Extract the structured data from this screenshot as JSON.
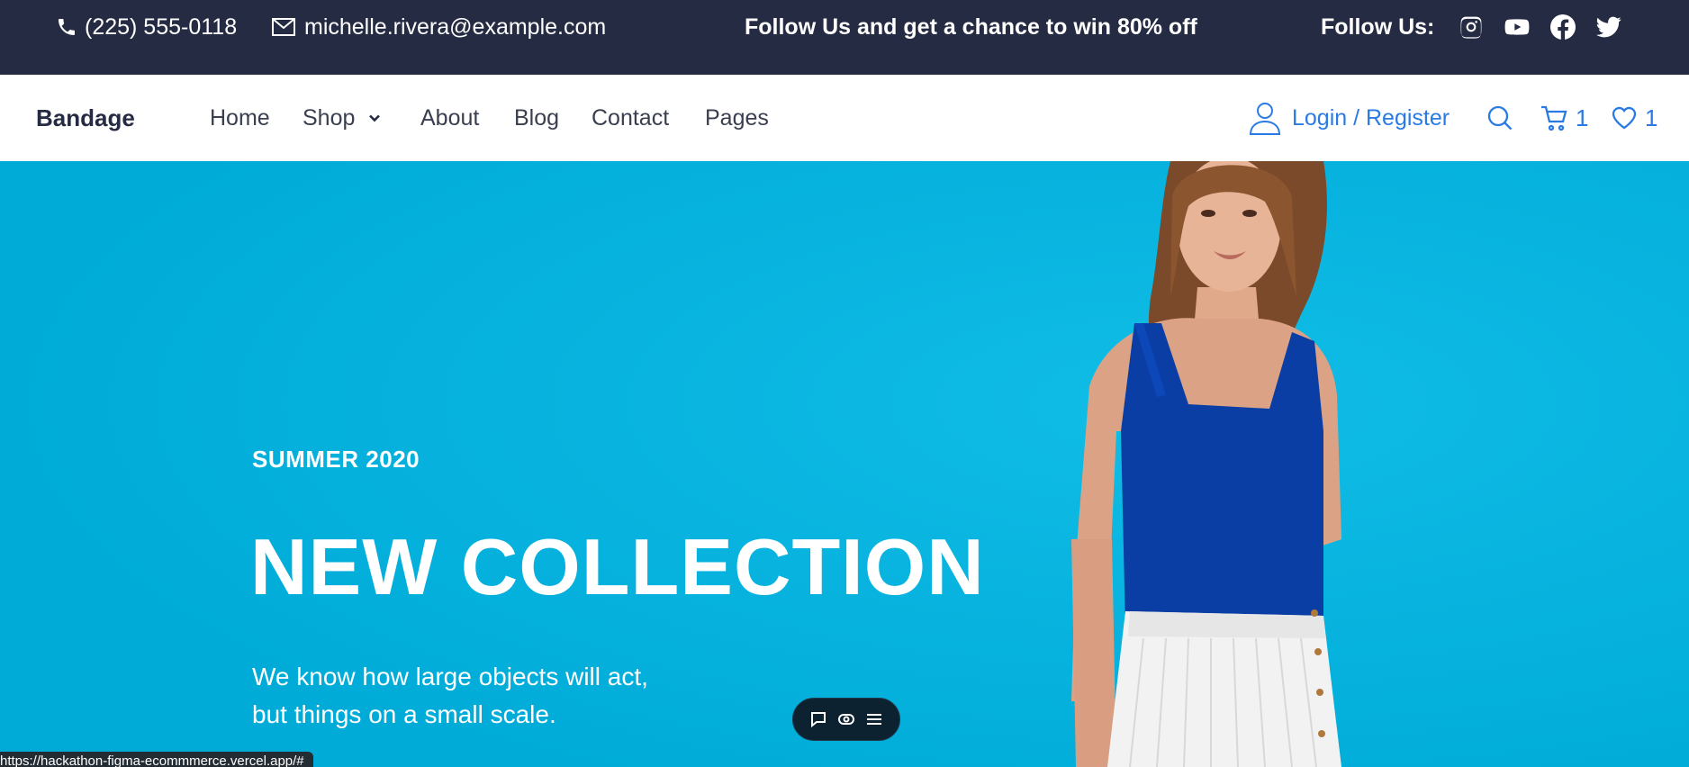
{
  "topbar": {
    "phone": "(225) 555-0118",
    "email": "michelle.rivera@example.com",
    "promo": "Follow Us and get a chance to win 80% off",
    "follow_label": "Follow Us:",
    "social_icons": [
      "instagram-icon",
      "youtube-icon",
      "facebook-icon",
      "twitter-icon"
    ]
  },
  "nav": {
    "brand": "Bandage",
    "links": [
      "Home",
      "Shop",
      "About",
      "Blog",
      "Contact",
      "Pages"
    ],
    "login": "Login / Register",
    "cart_count": "1",
    "wishlist_count": "1"
  },
  "hero": {
    "season": "SUMMER 2020",
    "headline": "NEW COLLECTION",
    "subtext_line1": "We know how large objects will act,",
    "subtext_line2": "but things on a small scale."
  },
  "status_bar": {
    "url": "https://hackathon-figma-ecommmerce.vercel.app/#"
  },
  "colors": {
    "topbar_bg": "#252b42",
    "hero_bg": "#00b4e0",
    "accent": "#2a7ae4",
    "text_dark": "#252b42"
  }
}
